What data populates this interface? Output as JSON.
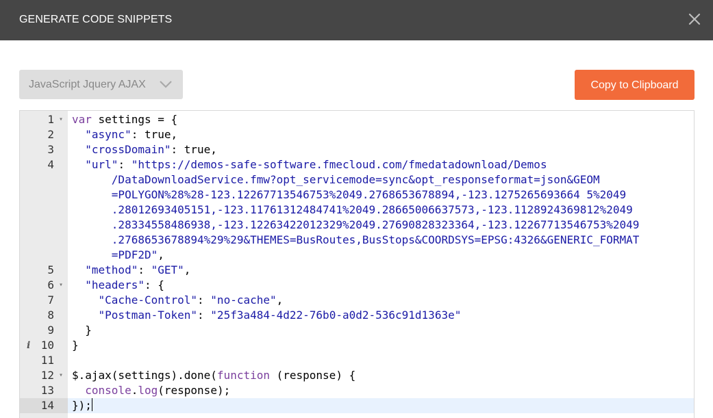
{
  "dialog": {
    "title": "GENERATE CODE SNIPPETS",
    "close_icon": "close-icon"
  },
  "toolbar": {
    "language_select": "JavaScript Jquery AJAX",
    "copy_label": "Copy to Clipboard"
  },
  "colors": {
    "titlebar": "#464646",
    "accent": "#f26b3a",
    "keyword": "#7a3e9d",
    "string": "#1a1aa6",
    "active_line": "#e8f2fe"
  },
  "editor": {
    "active_line": 14,
    "lines": [
      {
        "num": "1",
        "fold": true,
        "info": false,
        "segments": [
          [
            "k",
            "var"
          ],
          [
            "p",
            " settings "
          ],
          [
            "p",
            "= {"
          ]
        ]
      },
      {
        "num": "2",
        "fold": false,
        "info": false,
        "segments": [
          [
            "p",
            "  "
          ],
          [
            "s",
            "\"async\""
          ],
          [
            "p",
            ": true,"
          ]
        ]
      },
      {
        "num": "3",
        "fold": false,
        "info": false,
        "segments": [
          [
            "p",
            "  "
          ],
          [
            "s",
            "\"crossDomain\""
          ],
          [
            "p",
            ": true,"
          ]
        ]
      },
      {
        "num": "4",
        "fold": false,
        "info": false,
        "segments": [
          [
            "p",
            "  "
          ],
          [
            "s",
            "\"url\""
          ],
          [
            "p",
            ": "
          ],
          [
            "s",
            "\"https://demos-safe-software.fmecloud.com/fmedatadownload/Demos"
          ]
        ]
      },
      {
        "num": "",
        "fold": false,
        "info": false,
        "segments": [
          [
            "s",
            "      /DataDownloadService.fmw?opt_servicemode=sync&opt_responseformat=json&GEOM"
          ]
        ]
      },
      {
        "num": "",
        "fold": false,
        "info": false,
        "segments": [
          [
            "s",
            "      =POLYGON%28%28-123.12267713546753%2049.2768653678894,-123.1275265693664 5%2049"
          ]
        ]
      },
      {
        "num": "",
        "fold": false,
        "info": false,
        "segments": [
          [
            "s",
            "      .28012693405151,-123.11761312484741%2049.28665006637573,-123.1128924369812%2049"
          ]
        ]
      },
      {
        "num": "",
        "fold": false,
        "info": false,
        "segments": [
          [
            "s",
            "      .28334558486938,-123.12263422012329%2049.27690828323364,-123.12267713546753%2049"
          ]
        ]
      },
      {
        "num": "",
        "fold": false,
        "info": false,
        "segments": [
          [
            "s",
            "      .2768653678894%29%29&THEMES=BusRoutes,BusStops&COORDSYS=EPSG:4326&GENERIC_FORMAT"
          ]
        ]
      },
      {
        "num": "",
        "fold": false,
        "info": false,
        "segments": [
          [
            "s",
            "      =PDF2D\""
          ],
          [
            "p",
            ","
          ]
        ]
      },
      {
        "num": "5",
        "fold": false,
        "info": false,
        "segments": [
          [
            "p",
            "  "
          ],
          [
            "s",
            "\"method\""
          ],
          [
            "p",
            ": "
          ],
          [
            "s",
            "\"GET\""
          ],
          [
            "p",
            ","
          ]
        ]
      },
      {
        "num": "6",
        "fold": true,
        "info": false,
        "segments": [
          [
            "p",
            "  "
          ],
          [
            "s",
            "\"headers\""
          ],
          [
            "p",
            ": {"
          ]
        ]
      },
      {
        "num": "7",
        "fold": false,
        "info": false,
        "segments": [
          [
            "p",
            "    "
          ],
          [
            "s",
            "\"Cache-Control\""
          ],
          [
            "p",
            ": "
          ],
          [
            "s",
            "\"no-cache\""
          ],
          [
            "p",
            ","
          ]
        ]
      },
      {
        "num": "8",
        "fold": false,
        "info": false,
        "segments": [
          [
            "p",
            "    "
          ],
          [
            "s",
            "\"Postman-Token\""
          ],
          [
            "p",
            ": "
          ],
          [
            "s",
            "\"25f3a484-4d22-76b0-a0d2-536c91d1363e\""
          ]
        ]
      },
      {
        "num": "9",
        "fold": false,
        "info": false,
        "segments": [
          [
            "p",
            "  }"
          ]
        ]
      },
      {
        "num": "10",
        "fold": false,
        "info": true,
        "segments": [
          [
            "p",
            "}"
          ]
        ]
      },
      {
        "num": "11",
        "fold": false,
        "info": false,
        "segments": []
      },
      {
        "num": "12",
        "fold": true,
        "info": false,
        "segments": [
          [
            "p",
            "$.ajax(settings).done("
          ],
          [
            "k",
            "function"
          ],
          [
            "p",
            " (response) {"
          ]
        ]
      },
      {
        "num": "13",
        "fold": false,
        "info": false,
        "segments": [
          [
            "p",
            "  "
          ],
          [
            "k",
            "console"
          ],
          [
            "p",
            "."
          ],
          [
            "k",
            "log"
          ],
          [
            "p",
            "(response);"
          ]
        ]
      },
      {
        "num": "14",
        "fold": false,
        "info": false,
        "segments": [
          [
            "p",
            "});"
          ]
        ]
      }
    ]
  }
}
